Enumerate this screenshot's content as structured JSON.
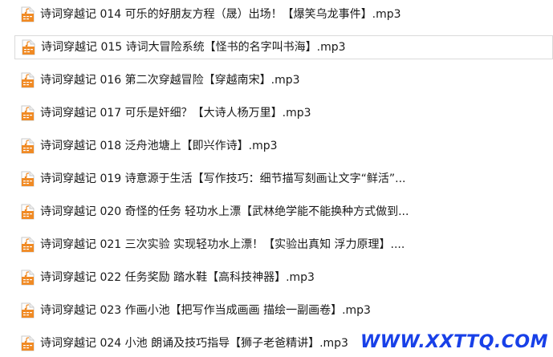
{
  "files": [
    {
      "name": "诗词穿越记 014 可乐的好朋友方程（晟）出场！【爆笑乌龙事件】.mp3",
      "icon": "audio-file-icon",
      "selected": false
    },
    {
      "name": "诗词穿越记 015 诗词大冒险系统【怪书的名字叫书海】.mp3",
      "icon": "audio-file-icon",
      "selected": true
    },
    {
      "name": "诗词穿越记 016 第二次穿越冒险【穿越南宋】.mp3",
      "icon": "audio-file-icon",
      "selected": false
    },
    {
      "name": "诗词穿越记 017 可乐是奸细？【大诗人杨万里】.mp3",
      "icon": "audio-file-icon",
      "selected": false
    },
    {
      "name": "诗词穿越记 018 泛舟池塘上【即兴作诗】.mp3",
      "icon": "audio-file-icon",
      "selected": false
    },
    {
      "name": "诗词穿越记 019 诗意源于生活【写作技巧：细节描写刻画让文字“鲜活”...",
      "icon": "audio-file-icon",
      "selected": false
    },
    {
      "name": "诗词穿越记 020 奇怪的任务 轻功水上漂【武林绝学能不能换种方式做到...",
      "icon": "audio-file-icon",
      "selected": false
    },
    {
      "name": "诗词穿越记 021 三次实验 实现轻功水上漂！【实验出真知 浮力原理】....",
      "icon": "audio-file-icon",
      "selected": false
    },
    {
      "name": "诗词穿越记 022 任务奖励 踏水鞋【高科技神器】.mp3",
      "icon": "audio-file-icon",
      "selected": false
    },
    {
      "name": "诗词穿越记 023 作画小池【把写作当成画画 描绘一副画卷】.mp3",
      "icon": "audio-file-icon",
      "selected": false
    },
    {
      "name": "诗词穿越记 024 小池 朗诵及技巧指导【狮子老爸精讲】.mp3",
      "icon": "audio-file-icon",
      "selected": false
    }
  ],
  "watermark": "WWW.XXTTQ.COM",
  "colors": {
    "icon_orange": "#f08a24",
    "watermark_blue": "#1840e8",
    "text": "#1a1a1a"
  }
}
